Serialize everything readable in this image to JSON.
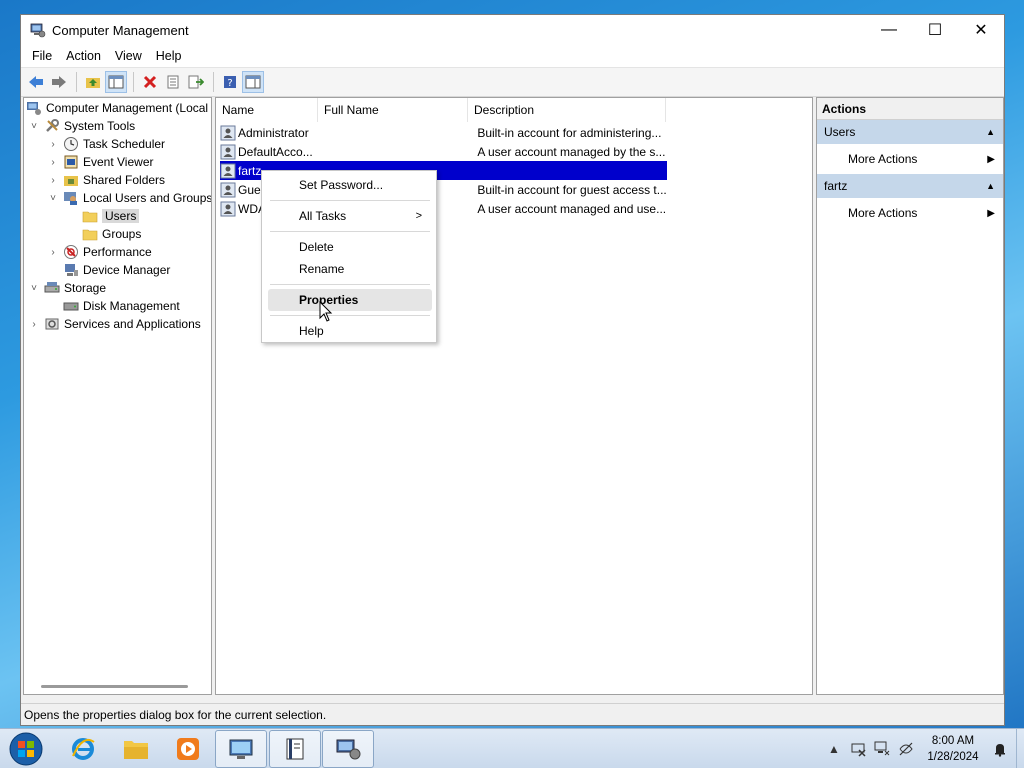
{
  "window": {
    "title": "Computer Management",
    "controls": {
      "minimize": "—",
      "maximize": "☐",
      "close": "✕"
    }
  },
  "menu": [
    "File",
    "Action",
    "View",
    "Help"
  ],
  "tree": [
    {
      "label": "Computer Management (Local",
      "icon": "computer-management-icon",
      "expander": ""
    },
    {
      "label": "System Tools",
      "icon": "tools-icon",
      "expander": "˅"
    },
    {
      "label": "Task Scheduler",
      "icon": "clock-icon",
      "expander": "›"
    },
    {
      "label": "Event Viewer",
      "icon": "event-viewer-icon",
      "expander": "›"
    },
    {
      "label": "Shared Folders",
      "icon": "shared-folder-icon",
      "expander": "›"
    },
    {
      "label": "Local Users and Groups",
      "icon": "users-icon",
      "expander": "˅"
    },
    {
      "label": "Users",
      "icon": "folder-icon",
      "expander": ""
    },
    {
      "label": "Groups",
      "icon": "folder-icon",
      "expander": ""
    },
    {
      "label": "Performance",
      "icon": "performance-icon",
      "expander": "›"
    },
    {
      "label": "Device Manager",
      "icon": "device-manager-icon",
      "expander": ""
    },
    {
      "label": "Storage",
      "icon": "storage-icon",
      "expander": "˅"
    },
    {
      "label": "Disk Management",
      "icon": "disk-icon",
      "expander": ""
    },
    {
      "label": "Services and Applications",
      "icon": "services-icon",
      "expander": "›"
    }
  ],
  "columns": [
    "Name",
    "Full Name",
    "Description"
  ],
  "users": [
    {
      "name": "Administrator",
      "full_name": "",
      "description": "Built-in account for administering..."
    },
    {
      "name": "DefaultAcco...",
      "full_name": "",
      "description": "A user account managed by the s..."
    },
    {
      "name": "fartz",
      "full_name": "",
      "description": ""
    },
    {
      "name": "Gues",
      "full_name": "",
      "description": "Built-in account for guest access t..."
    },
    {
      "name": "WDA",
      "full_name": "",
      "description": "A user account managed and use..."
    }
  ],
  "context_menu": {
    "items": [
      {
        "label": "Set Password...",
        "submenu": ""
      },
      {
        "label": "All Tasks",
        "submenu": ">"
      },
      {
        "label": "Delete",
        "submenu": ""
      },
      {
        "label": "Rename",
        "submenu": ""
      },
      {
        "label": "Properties",
        "submenu": ""
      },
      {
        "label": "Help",
        "submenu": ""
      }
    ]
  },
  "actions": {
    "header": "Actions",
    "sections": [
      {
        "title": "Users",
        "item": "More Actions"
      },
      {
        "title": "fartz",
        "item": "More Actions"
      }
    ]
  },
  "status": "Opens the properties dialog box for the current selection.",
  "clock": {
    "time": "8:00 AM",
    "date": "1/28/2024"
  },
  "colors": {
    "selection": "#0000cc",
    "section_bg": "#c5d7ea"
  }
}
